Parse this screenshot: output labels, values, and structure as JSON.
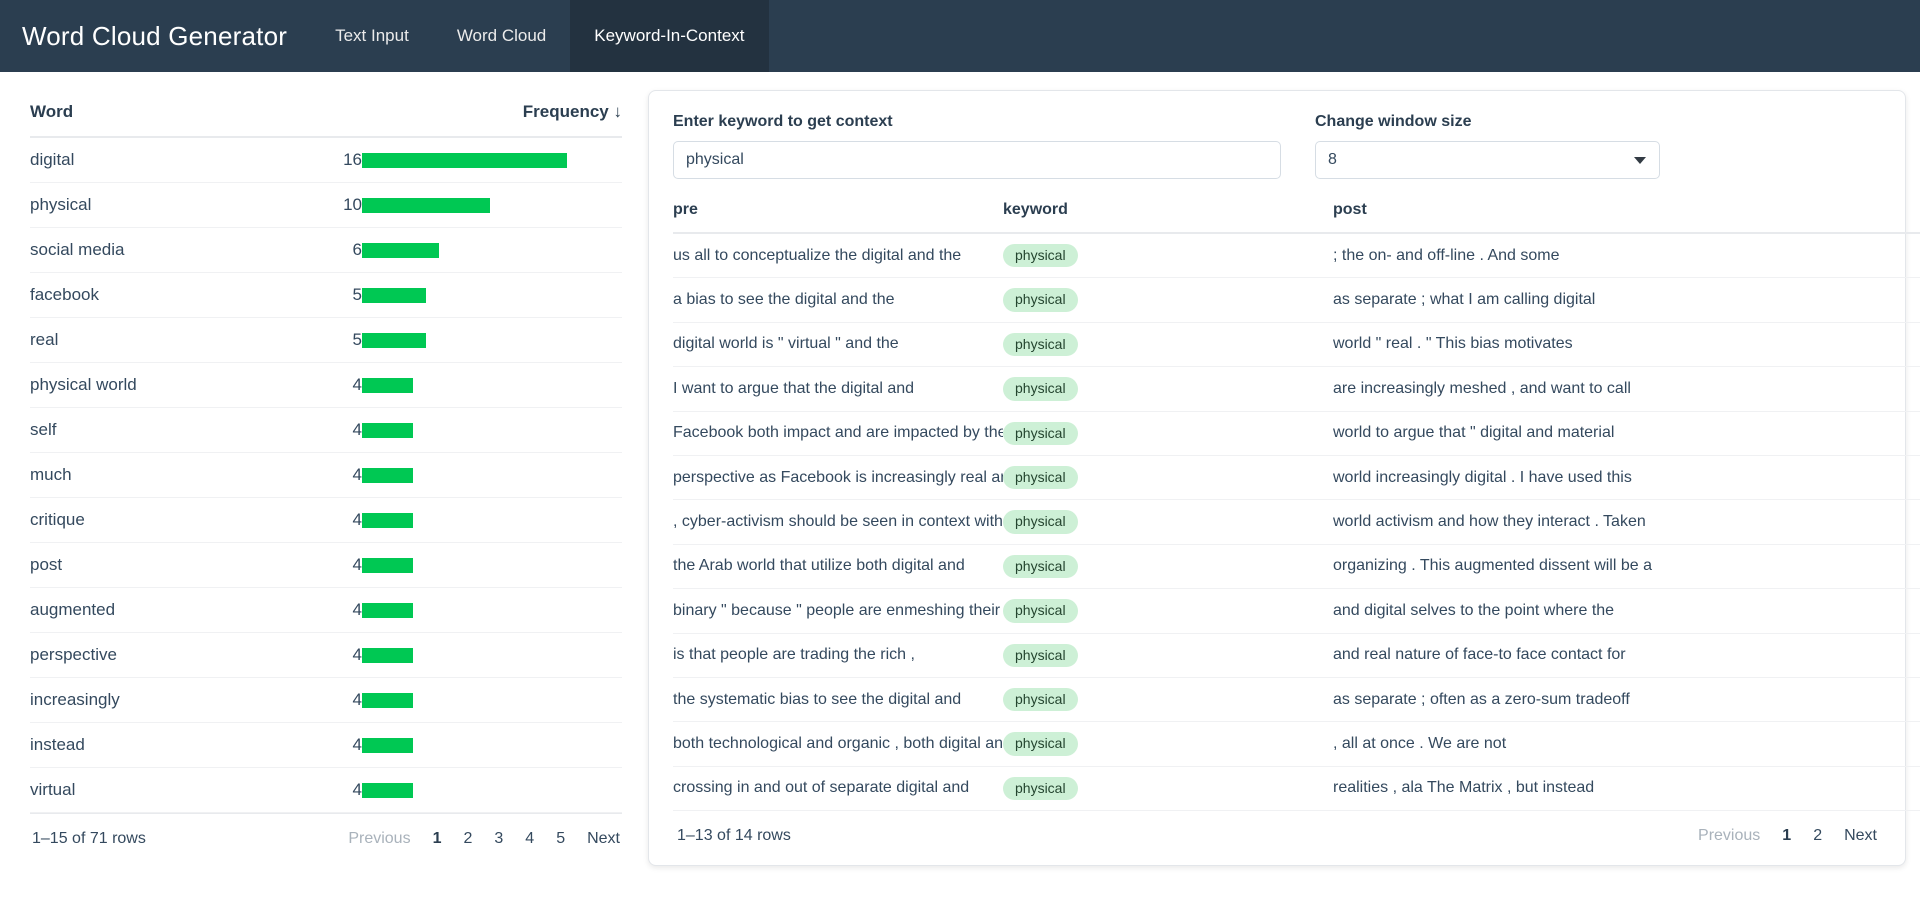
{
  "navbar": {
    "brand": "Word Cloud Generator",
    "tabs": [
      {
        "label": "Text Input",
        "active": false
      },
      {
        "label": "Word Cloud",
        "active": false
      },
      {
        "label": "Keyword-In-Context",
        "active": true
      }
    ]
  },
  "colors": {
    "navbar_bg": "#2b3e50",
    "navbar_active_bg": "#233240",
    "bar_green": "#00c853",
    "badge_bg": "#cdf0d6",
    "badge_text": "#24452f",
    "text": "#34495e"
  },
  "word_table": {
    "columns": {
      "word": "Word",
      "frequency": "Frequency",
      "sort_indicator": "↓"
    },
    "max_frequency": 16,
    "rows": [
      {
        "word": "digital",
        "frequency": 16
      },
      {
        "word": "physical",
        "frequency": 10
      },
      {
        "word": "social media",
        "frequency": 6
      },
      {
        "word": "facebook",
        "frequency": 5
      },
      {
        "word": "real",
        "frequency": 5
      },
      {
        "word": "physical world",
        "frequency": 4
      },
      {
        "word": "self",
        "frequency": 4
      },
      {
        "word": "much",
        "frequency": 4
      },
      {
        "word": "critique",
        "frequency": 4
      },
      {
        "word": "post",
        "frequency": 4
      },
      {
        "word": "augmented",
        "frequency": 4
      },
      {
        "word": "perspective",
        "frequency": 4
      },
      {
        "word": "increasingly",
        "frequency": 4
      },
      {
        "word": "instead",
        "frequency": 4
      },
      {
        "word": "virtual",
        "frequency": 4
      }
    ],
    "footer": {
      "rows_label": "1–15 of 71 rows",
      "previous": "Previous",
      "pages": [
        "1",
        "2",
        "3",
        "4",
        "5"
      ],
      "current_page": "1",
      "next": "Next"
    }
  },
  "kwic": {
    "keyword_control": {
      "label": "Enter keyword to get context",
      "value": "physical",
      "placeholder": ""
    },
    "window_control": {
      "label": "Change window size",
      "value": "8"
    },
    "columns": {
      "pre": "pre",
      "keyword": "keyword",
      "post": "post"
    },
    "rows": [
      {
        "pre": "us all to conceptualize the digital and the",
        "keyword": "physical",
        "post": "; the on- and off-line . And some"
      },
      {
        "pre": "a bias to see the digital and the",
        "keyword": "physical",
        "post": "as separate ; what I am calling digital"
      },
      {
        "pre": "digital world is \" virtual \" and the",
        "keyword": "physical",
        "post": "world \" real . \" This bias motivates"
      },
      {
        "pre": "I want to argue that the digital and",
        "keyword": "physical",
        "post": "are increasingly meshed , and want to call"
      },
      {
        "pre": "Facebook both impact and are impacted by the",
        "keyword": "physical",
        "post": "world to argue that \" digital and material"
      },
      {
        "pre": "perspective as Facebook is increasingly real and our",
        "keyword": "physical",
        "post": "world increasingly digital . I have used this"
      },
      {
        "pre": ", cyber-activism should be seen in context with",
        "keyword": "physical",
        "post": "world activism and how they interact . Taken"
      },
      {
        "pre": "the Arab world that utilize both digital and",
        "keyword": "physical",
        "post": "organizing . This augmented dissent will be a"
      },
      {
        "pre": "binary \" because \" people are enmeshing their",
        "keyword": "physical",
        "post": "and digital selves to the point where the"
      },
      {
        "pre": "is that people are trading the rich ,",
        "keyword": "physical",
        "post": "and real nature of face-to face contact for"
      },
      {
        "pre": "the systematic bias to see the digital and",
        "keyword": "physical",
        "post": "as separate ; often as a zero-sum tradeoff"
      },
      {
        "pre": "both technological and organic , both digital and",
        "keyword": "physical",
        "post": ", all at once . We are not"
      },
      {
        "pre": "crossing in and out of separate digital and",
        "keyword": "physical",
        "post": "realities , ala The Matrix , but instead"
      }
    ],
    "footer": {
      "rows_label": "1–13 of 14 rows",
      "previous": "Previous",
      "pages": [
        "1",
        "2"
      ],
      "current_page": "1",
      "next": "Next"
    }
  }
}
